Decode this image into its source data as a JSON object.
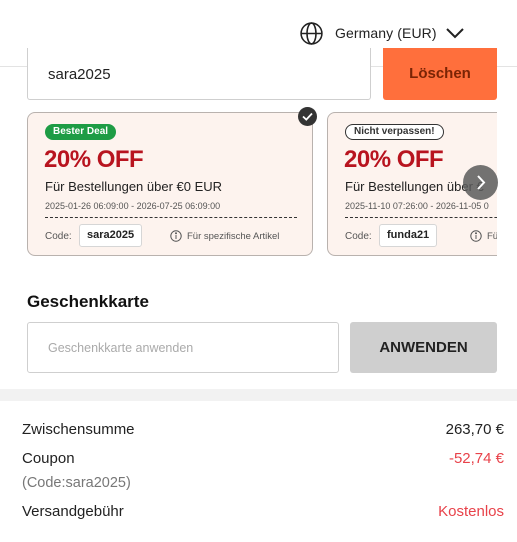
{
  "header": {
    "region_label": "Germany (EUR)",
    "region_icon": "globe-icon",
    "dropdown_icon": "chevron-down-icon"
  },
  "coupon_entry": {
    "value": "sara2025",
    "clear_label": "Löschen",
    "clear_color": "#ff6f3c"
  },
  "coupons": [
    {
      "badge": "Bester Deal",
      "badge_color": "#1e9c45",
      "discount": "20% OFF",
      "condition": "Für Bestellungen über €0 EUR",
      "validity": "2025-01-26 06:09:00 - 2026-07-25 06:09:00",
      "code_label": "Code:",
      "code": "sara2025",
      "note": "Für spezifische Artikel",
      "selected": true
    },
    {
      "badge": "Nicht verpassen!",
      "discount": "20% OFF",
      "condition": "Für Bestellungen über €",
      "validity": "2025-11-10 07:26:00 - 2026-11-05 0",
      "code_label": "Code:",
      "code": "funda21",
      "note": "Fü",
      "selected": false
    }
  ],
  "gift_card": {
    "title": "Geschenkkarte",
    "placeholder": "Geschenkkarte anwenden",
    "apply_label": "ANWENDEN"
  },
  "summary": {
    "subtotal_label": "Zwischensumme",
    "subtotal_value": "263,70 €",
    "coupon_label": "Coupon",
    "coupon_value": "-52,74 €",
    "coupon_code_note": "(Code:sara2025)",
    "shipping_label": "Versandgebühr",
    "shipping_value": "Kostenlos",
    "discount_color": "#e8424a"
  }
}
